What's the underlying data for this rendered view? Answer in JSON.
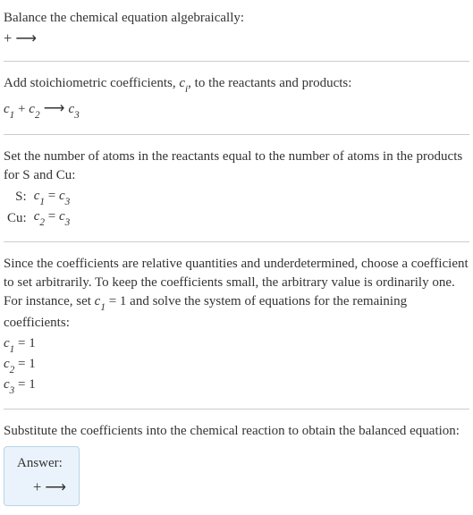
{
  "section1": {
    "title": "Balance the chemical equation algebraically:",
    "reaction": " +  ⟶ "
  },
  "section2": {
    "line1_pre": "Add stoichiometric coefficients, ",
    "line1_ci": "c",
    "line1_ci_sub": "i",
    "line1_post": ", to the reactants and products:",
    "react_c1": "c",
    "react_c1_sub": "1",
    "react_plus": " + ",
    "react_c2": "c",
    "react_c2_sub": "2",
    "react_arrow": "  ⟶  ",
    "react_c3": "c",
    "react_c3_sub": "3"
  },
  "section3": {
    "intro": "Set the number of atoms in the reactants equal to the number of atoms in the products for S and Cu:",
    "rows": [
      {
        "label": "S: ",
        "lhs_c": "c",
        "lhs_sub": "1",
        "eq": " = ",
        "rhs_c": "c",
        "rhs_sub": "3"
      },
      {
        "label": "Cu: ",
        "lhs_c": "c",
        "lhs_sub": "2",
        "eq": " = ",
        "rhs_c": "c",
        "rhs_sub": "3"
      }
    ]
  },
  "section4": {
    "intro_pre": "Since the coefficients are relative quantities and underdetermined, choose a coefficient to set arbitrarily. To keep the coefficients small, the arbitrary value is ordinarily one. For instance, set ",
    "intro_c": "c",
    "intro_c_sub": "1",
    "intro_post": " = 1 and solve the system of equations for the remaining coefficients:",
    "coeffs": [
      {
        "c": "c",
        "sub": "1",
        "val": " = 1"
      },
      {
        "c": "c",
        "sub": "2",
        "val": " = 1"
      },
      {
        "c": "c",
        "sub": "3",
        "val": " = 1"
      }
    ]
  },
  "section5": {
    "intro": "Substitute the coefficients into the chemical reaction to obtain the balanced equation:",
    "answer_label": "Answer:",
    "answer_reaction": " +  ⟶ "
  }
}
